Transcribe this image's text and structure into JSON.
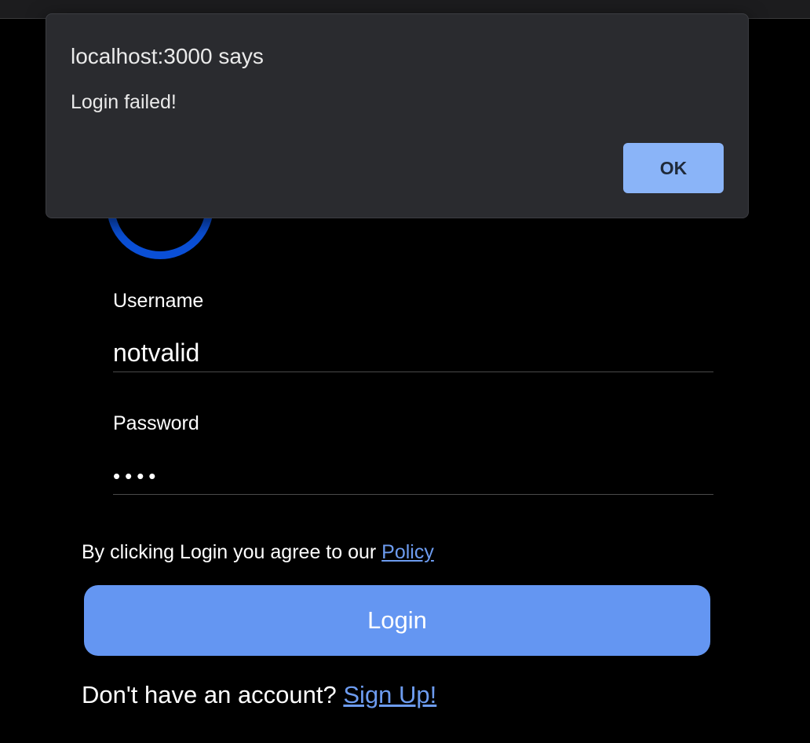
{
  "dialog": {
    "title": "localhost:3000 says",
    "message": "Login failed!",
    "ok_label": "OK"
  },
  "form": {
    "username": {
      "label": "Username",
      "value": "notvalid"
    },
    "password": {
      "label": "Password",
      "masked_value": "••••"
    },
    "policy": {
      "prefix": "By clicking Login you agree to our ",
      "link_label": "Policy"
    },
    "login_label": "Login",
    "signup": {
      "prefix": "Don't have an account? ",
      "link_label": "Sign Up!"
    }
  },
  "colors": {
    "background": "#000000",
    "accent": "#6496f2",
    "link": "#6d9cf0",
    "logo_ring": "#0a4fd6",
    "dialog_bg": "#2a2b2f",
    "dialog_button": "#8ab4f8"
  }
}
